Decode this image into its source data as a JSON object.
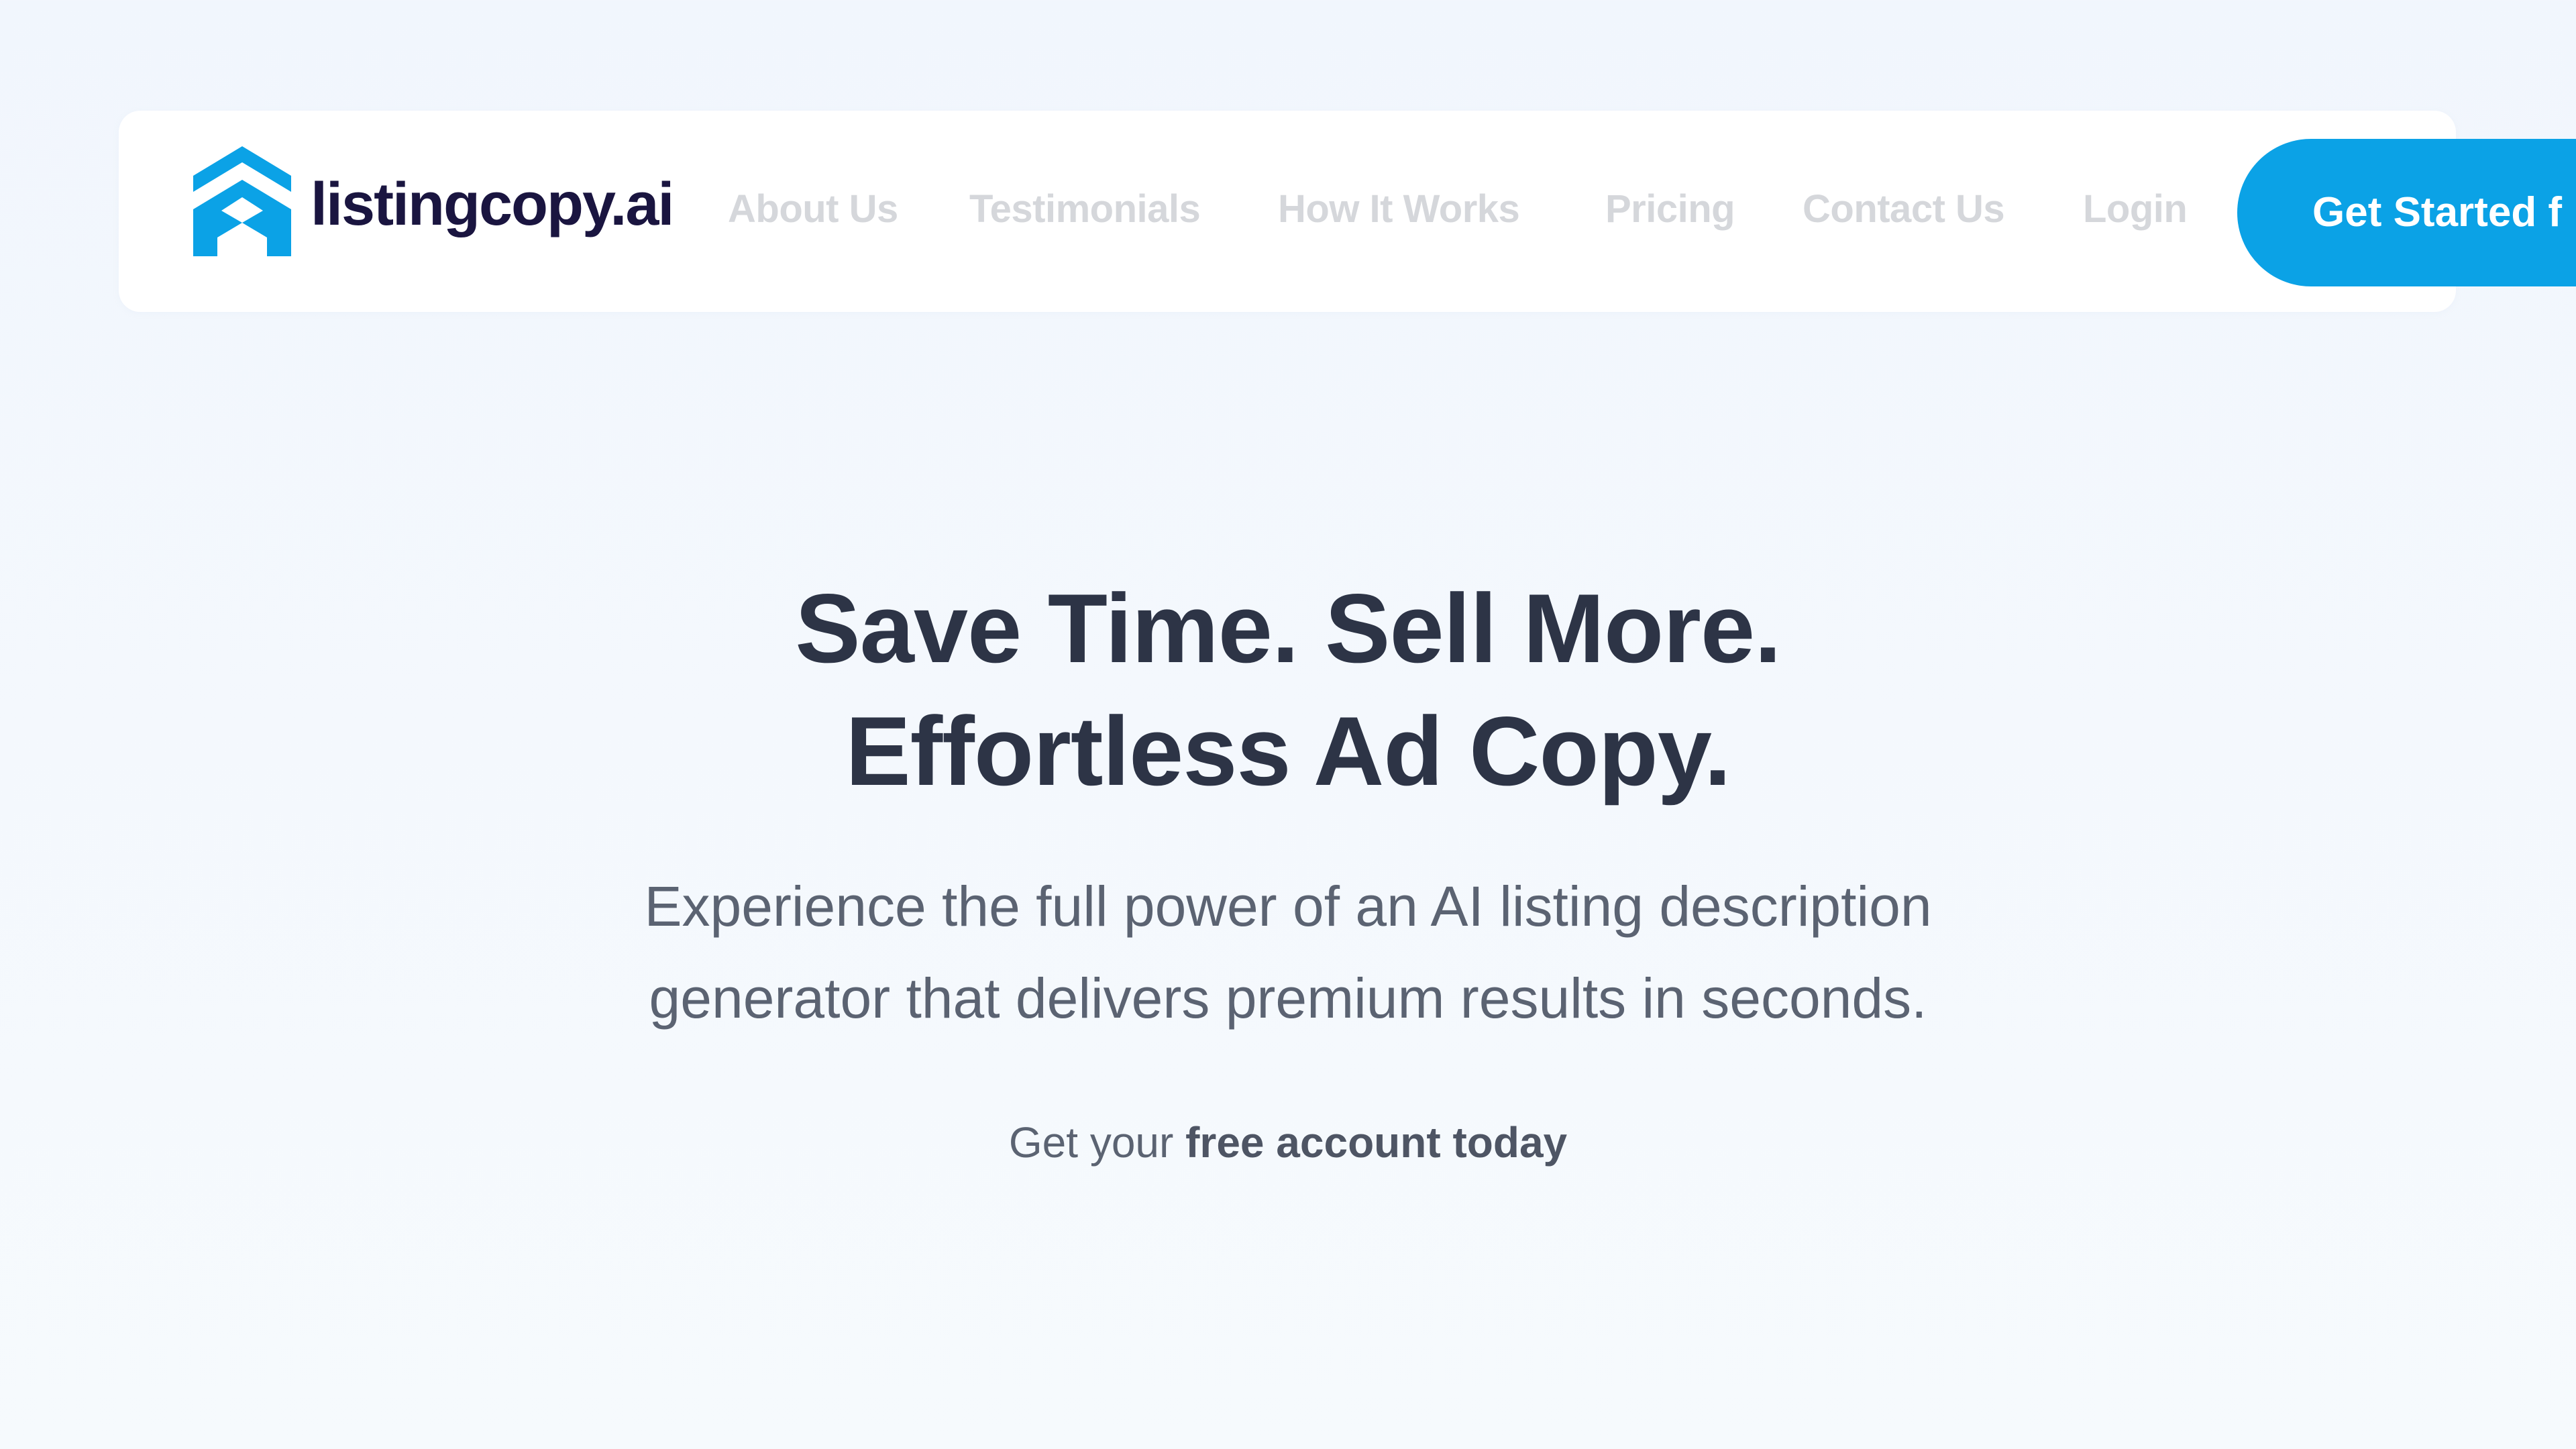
{
  "brand": {
    "name": "listingcopy.ai",
    "logo_icon": "house-chevron-icon",
    "accent_color": "#0ba2e6",
    "wordmark_color": "#1a1540"
  },
  "nav": {
    "items": [
      {
        "label": "About Us"
      },
      {
        "label": "Testimonials"
      },
      {
        "label": "How It Works"
      },
      {
        "label": "Pricing"
      },
      {
        "label": "Contact Us"
      },
      {
        "label": "Login"
      }
    ],
    "cta_label": "Get Started f"
  },
  "hero": {
    "title_line1": "Save Time. Sell More.",
    "title_line2": "Effortless Ad Copy.",
    "subtitle_line1": "Experience the full power of an AI listing description",
    "subtitle_line2": "generator that delivers premium results in seconds.",
    "cta_prefix": "Get your ",
    "cta_emphasis": "free account today"
  },
  "colors": {
    "heading": "#2d3446",
    "body_text": "#5b6372",
    "nav_text": "#d5d7db",
    "background": "#f3f8fd",
    "card": "#ffffff"
  }
}
